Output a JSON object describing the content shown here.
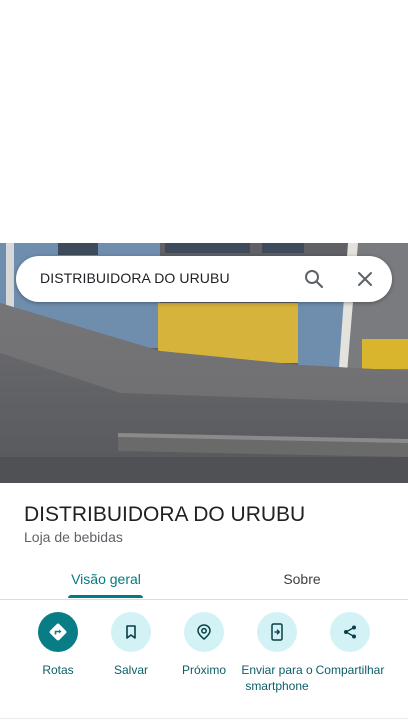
{
  "search": {
    "query": "DISTRIBUIDORA DO URUBU"
  },
  "place": {
    "title": "DISTRIBUIDORA DO URUBU",
    "category": "Loja de bebidas"
  },
  "tabs": [
    {
      "label": "Visão geral",
      "active": true
    },
    {
      "label": "Sobre",
      "active": false
    }
  ],
  "actions": [
    {
      "label": "Rotas",
      "icon": "directions-icon"
    },
    {
      "label": "Salvar",
      "icon": "bookmark-icon"
    },
    {
      "label": "Próximo",
      "icon": "nearby-icon"
    },
    {
      "label": "Enviar para o smartphone",
      "icon": "send-to-phone-icon"
    },
    {
      "label": "Compartilhar",
      "icon": "share-icon"
    }
  ],
  "colors": {
    "accent": "#087d86",
    "action_bg": "#d3f2f6",
    "action_label": "#0b5f67"
  }
}
